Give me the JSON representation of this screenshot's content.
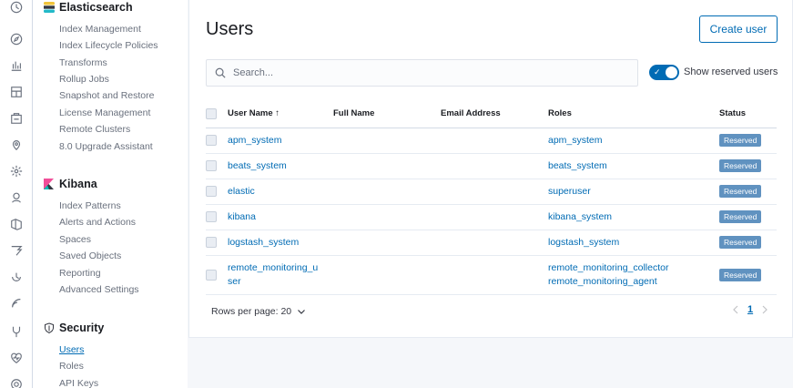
{
  "rail": {
    "icons": [
      "clock-icon",
      "compass-icon",
      "bar-chart-icon",
      "dashboard-icon",
      "canvas-icon",
      "maps-icon",
      "machine-learning-icon",
      "graph-icon",
      "apm-icon",
      "logs-icon",
      "uptime-icon",
      "siem-icon",
      "dev-tools-icon",
      "stack-monitoring-icon",
      "management-icon"
    ]
  },
  "sidenav": {
    "elasticsearch": {
      "title": "Elasticsearch",
      "items": [
        "Index Management",
        "Index Lifecycle Policies",
        "Transforms",
        "Rollup Jobs",
        "Snapshot and Restore",
        "License Management",
        "Remote Clusters",
        "8.0 Upgrade Assistant"
      ]
    },
    "kibana": {
      "title": "Kibana",
      "items": [
        "Index Patterns",
        "Alerts and Actions",
        "Spaces",
        "Saved Objects",
        "Reporting",
        "Advanced Settings"
      ]
    },
    "security": {
      "title": "Security",
      "items": [
        "Users",
        "Roles",
        "API Keys"
      ]
    }
  },
  "main": {
    "title": "Users",
    "create_button": "Create user",
    "search_placeholder": "Search...",
    "toggle_label": "Show reserved users",
    "columns": {
      "username": "User Name",
      "fullname": "Full Name",
      "email": "Email Address",
      "roles": "Roles",
      "status": "Status"
    },
    "rows": [
      {
        "username": "apm_system",
        "roles": [
          "apm_system"
        ],
        "status": "Reserved"
      },
      {
        "username": "beats_system",
        "roles": [
          "beats_system"
        ],
        "status": "Reserved"
      },
      {
        "username": "elastic",
        "roles": [
          "superuser"
        ],
        "status": "Reserved"
      },
      {
        "username": "kibana",
        "roles": [
          "kibana_system"
        ],
        "status": "Reserved"
      },
      {
        "username": "logstash_system",
        "roles": [
          "logstash_system"
        ],
        "status": "Reserved"
      },
      {
        "username": "remote_monitoring_u ser",
        "roles": [
          "remote_monitoring_collector",
          "remote_monitoring_agent"
        ],
        "status": "Reserved"
      }
    ],
    "rows_per_page": "Rows per page: 20",
    "current_page": "1"
  },
  "colors": {
    "accent": "#006bb4",
    "badge": "#6092c0",
    "text": "#343741"
  }
}
